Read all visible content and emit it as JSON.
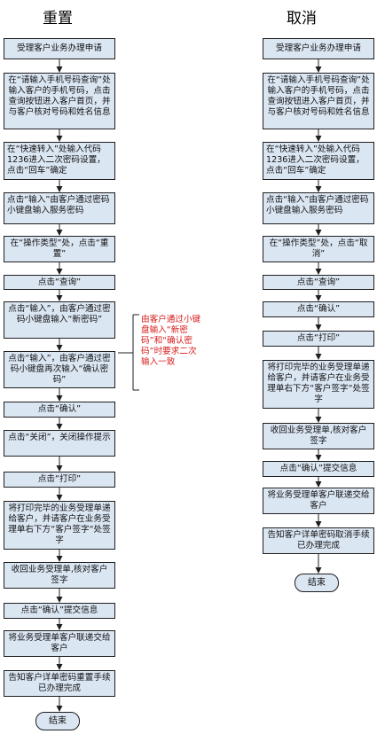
{
  "left": {
    "title": "重置",
    "steps": [
      "受理客户业务办理申请",
      "在“请输入手机号码查询”处输入客户的手机号码，点击查询按钮进入客户首页，并与客户核对号码和姓名信息",
      "在“快速转入”处输入代码1236进入二次密码设置，点击“回车”确定",
      "点击“输入”由客户通过密码小键盘输入服务密码",
      "在“操作类型”处，点击“重置”",
      "点击“查询”",
      "点击“输入”，由客户通过密码小键盘输入“新密码”",
      "点击“输入”，由客户通过密码小键盘再次输入“确认密码”",
      "点击“确认”",
      "点击“关闭”，关闭操作提示",
      "点击“打印”",
      "将打印完毕的业务受理单递给客户，并请客户在业务受理单右下方“客户签字“处签字",
      "收回业务受理单,核对客户签字",
      "点击“确认”提交信息",
      "将业务受理单客户联递交给客户",
      "告知客户详单密码重置手续已办理完成"
    ],
    "end": "结束"
  },
  "right": {
    "title": "取消",
    "steps": [
      "受理客户业务办理申请",
      "在“请输入手机号码查询”处输入客户的手机号码，点击查询按钮进入客户首页，并与客户核对号码和姓名信息",
      "在“快速转入”处输入代码1236进入二次密码设置，点击“回车”确定",
      "点击“输入”由客户通过密码小键盘输入服务密码",
      "在“操作类型”处，点击“取消”",
      "点击“查询”",
      "点击“确认”",
      "点击“打印”",
      "将打印完毕的业务受理单递给客户，并请客户在业务受理单右下方“客户签字“处签字",
      "收回业务受理单,核对客户签字",
      "点击“确认”提交信息",
      "将业务受理单客户联递交给客户",
      "告知客户详单密码取消手续已办理完成"
    ],
    "end": "结束"
  },
  "note": "由客户通过小键盘输入“新密码”和“确认密码”时要求二次输入一致",
  "colors": {
    "box_fill": "#dbe6f3",
    "note_text": "#d81b1b",
    "border": "#1f1f1f"
  }
}
